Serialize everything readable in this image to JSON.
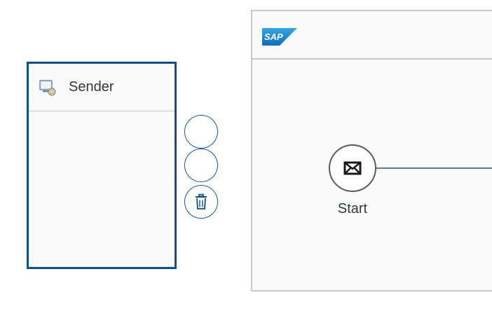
{
  "sender": {
    "label": "Sender",
    "icon": "sender-system-icon"
  },
  "context_actions": [
    {
      "name": "context-action-button-1",
      "icon": null
    },
    {
      "name": "context-action-button-2",
      "icon": null
    },
    {
      "name": "delete-button",
      "icon": "trash-icon"
    }
  ],
  "process": {
    "logo": "SAP",
    "start_event": {
      "label": "Start",
      "icon": "envelope-icon"
    }
  },
  "colors": {
    "selection_border": "#0a4f9c",
    "context_button_border": "#0a5ab4",
    "pool_border": "#c8c8c8",
    "flow_line": "#4a7fb8",
    "sap_blue": "#1f8fd6"
  }
}
